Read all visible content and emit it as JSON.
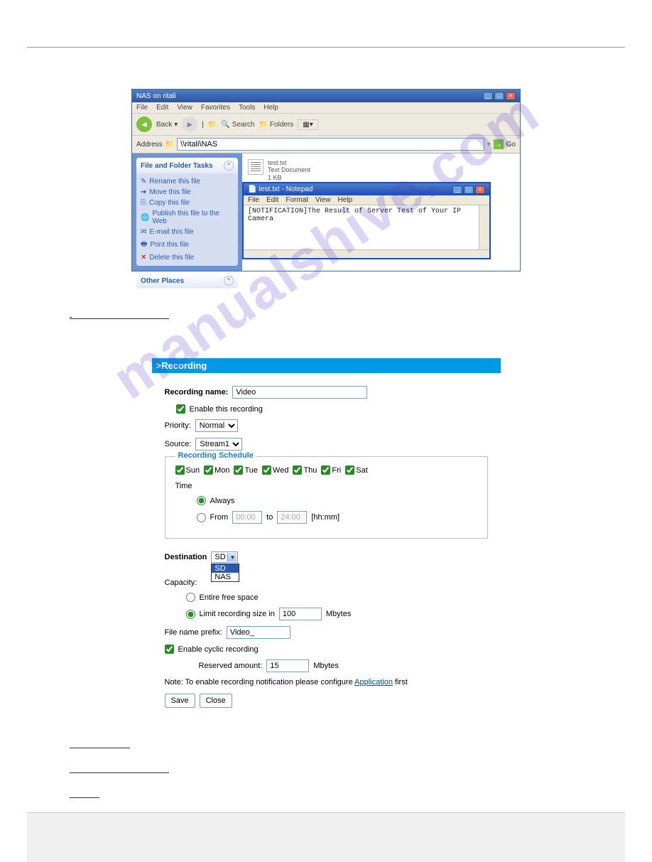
{
  "explorer": {
    "title": "NAS on ritali",
    "menu": [
      "File",
      "Edit",
      "View",
      "Favorites",
      "Tools",
      "Help"
    ],
    "toolbar": {
      "back": "Back",
      "search": "Search",
      "folders": "Folders"
    },
    "address_label": "Address",
    "address_value": "\\\\ritali\\NAS",
    "go": "Go",
    "sidebar": {
      "tasks_title": "File and Folder Tasks",
      "tasks": [
        "Rename this file",
        "Move this file",
        "Copy this file",
        "Publish this file to the Web",
        "E-mail this file",
        "Print this file",
        "Delete this file"
      ],
      "other_title": "Other Places"
    },
    "file": {
      "name": "test.txt",
      "type": "Text Document",
      "size": "1 KB"
    }
  },
  "notepad": {
    "title": "test.txt - Notepad",
    "menu": [
      "File",
      "Edit",
      "Format",
      "View",
      "Help"
    ],
    "content": "[NOTIFICATION]The Result of Server Test of Your IP Camera"
  },
  "section_links": [
    "",
    "",
    ""
  ],
  "recording": {
    "heading": ">Recording",
    "name_label": "Recording name:",
    "name_value": "Video",
    "enable_label": "Enable this recording",
    "priority_label": "Priority:",
    "priority_value": "Normal",
    "source_label": "Source:",
    "source_value": "Stream1",
    "schedule": {
      "legend": "Recording Schedule",
      "days": [
        "Sun",
        "Mon",
        "Tue",
        "Wed",
        "Thu",
        "Fri",
        "Sat"
      ],
      "time_label": "Time",
      "always": "Always",
      "from": "From",
      "from_value": "00:00",
      "to": "to",
      "to_value": "24:00",
      "hint": "[hh:mm]"
    },
    "dest": {
      "label": "Destination",
      "selected": "SD",
      "options": [
        "SD",
        "NAS"
      ]
    },
    "capacity": {
      "label": "Capacity:"
    },
    "entire": "Entire free space",
    "limit": {
      "label": "Limit recording size in",
      "value": "100",
      "unit": "Mbytes"
    },
    "prefix": {
      "label": "File name prefix:",
      "value": "Video_"
    },
    "cyclic": "Enable cyclic recording",
    "reserved": {
      "label": "Reserved amount:",
      "value": "15",
      "unit": "Mbytes"
    },
    "note_pre": "Note: To enable recording notification please configure ",
    "note_link": "Application",
    "note_post": " first",
    "save": "Save",
    "close": "Close"
  },
  "watermark": "manualshive.com"
}
